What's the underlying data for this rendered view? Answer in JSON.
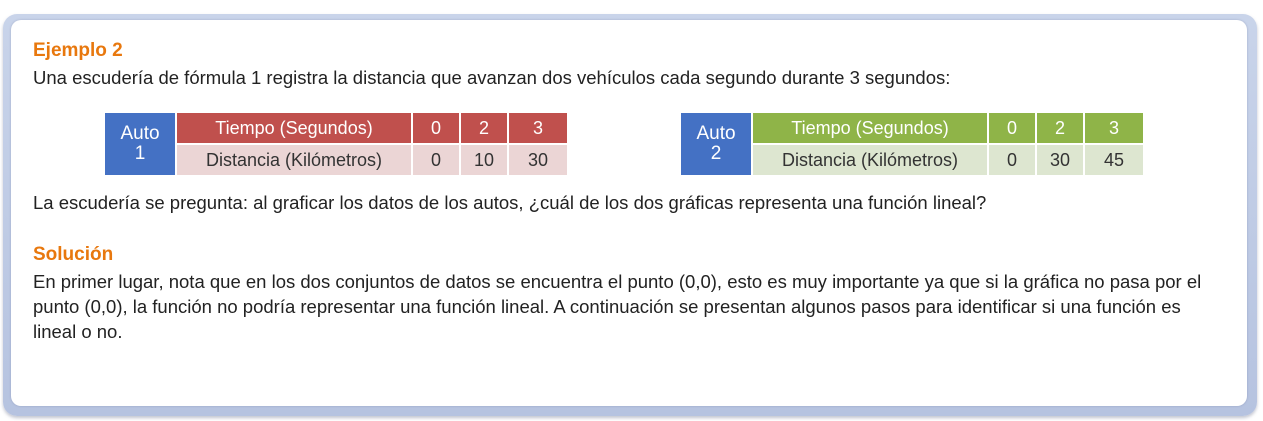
{
  "example": {
    "title": "Ejemplo 2",
    "intro": "Una escudería de fórmula 1 registra la distancia que avanzan dos vehículos cada segundo durante 3 segundos:"
  },
  "tables": [
    {
      "auto_label_line1": "Auto",
      "auto_label_line2": "1",
      "header": {
        "label": "Tiempo (Segundos)",
        "values": [
          "0",
          "2",
          "3"
        ]
      },
      "row": {
        "label": "Distancia (Kilómetros)",
        "values": [
          "0",
          "10",
          "30"
        ]
      },
      "colors": {
        "header": "#c0504d",
        "row": "#ebd5d5",
        "auto": "#4471c4"
      }
    },
    {
      "auto_label_line1": "Auto",
      "auto_label_line2": "2",
      "header": {
        "label": "Tiempo (Segundos)",
        "values": [
          "0",
          "2",
          "3"
        ]
      },
      "row": {
        "label": "Distancia (Kilómetros)",
        "values": [
          "0",
          "30",
          "45"
        ]
      },
      "colors": {
        "header": "#8fb448",
        "row": "#dde6d0",
        "auto": "#4471c4"
      }
    }
  ],
  "question": "La escudería se pregunta: al graficar los datos de los autos, ¿cuál de los dos gráficas representa una función lineal?",
  "solution": {
    "title": "Solución",
    "body": "En primer lugar, nota que en los dos conjuntos de datos se encuentra el punto (0,0), esto es muy importante ya que si la gráfica no pasa por el punto (0,0), la función no podría representar una función lineal. A continuación se presentan algunos pasos para identificar si una función es lineal o no."
  },
  "colors": {
    "heading": "#e8780e",
    "frame": "#c2cde6"
  }
}
